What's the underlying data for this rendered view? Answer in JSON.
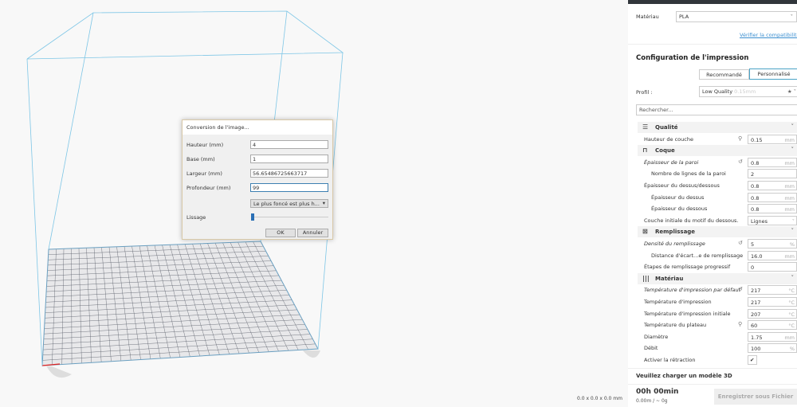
{
  "viewport": {
    "dimensions": "0.0 x 0.0 x 0.0 mm"
  },
  "dialog": {
    "title": "Conversion de l'image...",
    "fields": [
      {
        "label": "Hauteur (mm)",
        "value": "4"
      },
      {
        "label": "Base (mm)",
        "value": "1"
      },
      {
        "label": "Largeur (mm)",
        "value": "56.65486725663717"
      },
      {
        "label": "Profondeur (mm)",
        "value": "99"
      }
    ],
    "mode_select": "Le plus foncé est plus h...",
    "smoothing_label": "Lissage",
    "smoothing_value": 0,
    "ok": "OK",
    "cancel": "Annuler"
  },
  "sidebar": {
    "material_label": "Matériau",
    "material_value": "PLA",
    "compat_link": "Vérifier la compatibilité",
    "config_title": "Configuration de l'impression",
    "tab_recommended": "Recommandé",
    "tab_custom": "Personnalisé",
    "profile_label": "Profil :",
    "profile_value": "Low Quality",
    "profile_hint": "0.15mm",
    "search_placeholder": "Rechercher...",
    "rows": [
      {
        "type": "cat",
        "label": "Qualité",
        "icon": "quality-icon",
        "glyph": "☰"
      },
      {
        "label": "Hauteur de couche",
        "value": "0.15",
        "unit": "mm",
        "icon": "link-icon"
      },
      {
        "type": "cat",
        "label": "Coque",
        "icon": "shell-icon",
        "glyph": "⊓"
      },
      {
        "label": "Épaisseur de la paroi",
        "value": "0.8",
        "unit": "mm",
        "italic": true,
        "icon": "reset-icon"
      },
      {
        "label": "Nombre de lignes de la paroi",
        "value": "2",
        "unit": "",
        "sub": true
      },
      {
        "label": "Épaisseur du dessus/dessous",
        "value": "0.8",
        "unit": "mm"
      },
      {
        "label": "Épaisseur du dessus",
        "value": "0.8",
        "unit": "mm",
        "sub": true
      },
      {
        "label": "Épaisseur du dessous",
        "value": "0.8",
        "unit": "mm",
        "sub": true
      },
      {
        "label": "Couche initiale du motif du dessous.",
        "value": "Lignes",
        "unit": "˅",
        "select": true
      },
      {
        "type": "cat",
        "label": "Remplissage",
        "icon": "infill-icon",
        "glyph": "⊠"
      },
      {
        "label": "Densité du remplissage",
        "value": "5",
        "unit": "%",
        "italic": true,
        "icon": "reset-icon"
      },
      {
        "label": "Distance d'écart...e de remplissage",
        "value": "16.0",
        "unit": "mm",
        "sub": true
      },
      {
        "label": "Étapes de remplissage progressif",
        "value": "0",
        "unit": ""
      },
      {
        "type": "cat",
        "label": "Matériau",
        "icon": "material-icon",
        "glyph": "|||"
      },
      {
        "label": "Température d'impression par défaut",
        "value": "217",
        "unit": "°C",
        "italic": true,
        "icon": "reset-icon"
      },
      {
        "label": "Température d'impression",
        "value": "217",
        "unit": "°C"
      },
      {
        "label": "Température d'impression initiale",
        "value": "207",
        "unit": "°C"
      },
      {
        "label": "Température du plateau",
        "value": "60",
        "unit": "°C",
        "icon": "link-icon"
      },
      {
        "label": "Diamètre",
        "value": "1.75",
        "unit": "mm"
      },
      {
        "label": "Débit",
        "value": "100",
        "unit": "%"
      },
      {
        "label": "Activer la rétraction",
        "value": "✔",
        "unit": "",
        "checkbox": true
      }
    ],
    "load_model": "Veuillez charger un modèle 3D",
    "time": "00h 00min",
    "material_usage": "0.00m / ~ 0g",
    "save_button": "Enregistrer sous Fichier"
  }
}
